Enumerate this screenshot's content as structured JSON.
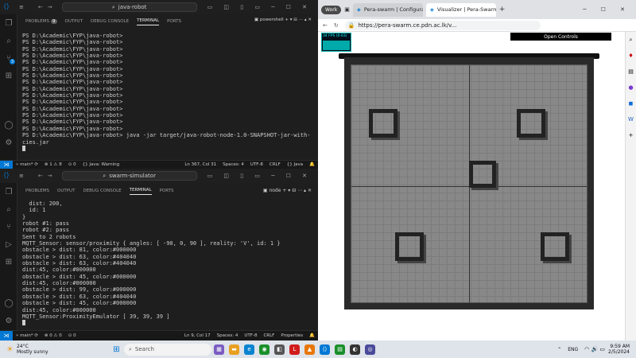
{
  "vscode": {
    "title": "java-robot",
    "top_tabs": [
      {
        "label": "PROBLEMS",
        "count": "9"
      },
      {
        "label": "OUTPUT"
      },
      {
        "label": "DEBUG CONSOLE"
      },
      {
        "label": "TERMINAL"
      },
      {
        "label": "PORTS"
      }
    ],
    "top_shell": "powershell",
    "top_lines": [
      "PS D:\\Academic\\FYP\\java-robot>",
      "PS D:\\Academic\\FYP\\java-robot>",
      "PS D:\\Academic\\FYP\\java-robot>",
      "PS D:\\Academic\\FYP\\java-robot>",
      "PS D:\\Academic\\FYP\\java-robot>",
      "PS D:\\Academic\\FYP\\java-robot>",
      "PS D:\\Academic\\FYP\\java-robot>",
      "PS D:\\Academic\\FYP\\java-robot>",
      "PS D:\\Academic\\FYP\\java-robot>",
      "PS D:\\Academic\\FYP\\java-robot>",
      "PS D:\\Academic\\FYP\\java-robot>",
      "PS D:\\Academic\\FYP\\java-robot>",
      "PS D:\\Academic\\FYP\\java-robot>",
      "PS D:\\Academic\\FYP\\java-robot>",
      "PS D:\\Academic\\FYP\\java-robot>",
      "PS D:\\Academic\\FYP\\java-robot> java -jar target/java-robot-node-1.0-SNAPSHOT-jar-with-dependen",
      "cies.jar"
    ],
    "top_status": {
      "branch": "main*",
      "sync": "⟳",
      "problems": "⊗ 1 ⚠ 8",
      "info": "⊙ 0",
      "java": "Java: Warning",
      "pos": "Ln 367, Col 31",
      "spaces": "Spaces: 4",
      "enc": "UTF-8",
      "eol": "CRLF",
      "lang": "{} Java"
    },
    "title2": "swarm-simulator",
    "bottom_tabs": [
      {
        "label": "PROBLEMS"
      },
      {
        "label": "OUTPUT"
      },
      {
        "label": "DEBUG CONSOLE"
      },
      {
        "label": "TERMINAL"
      },
      {
        "label": "PORTS"
      }
    ],
    "bottom_shell": "node",
    "bottom_lines": [
      "  dist: 200,",
      "  id: 1",
      "}",
      "robot #1: pass",
      "robot #2: pass",
      "Sent to 2 robots",
      "MQTT_Sensor: sensor/proximity { angles: [ -90, 0, 90 ], reality: 'V', id: 1 }",
      "obstacle > dist: 81, color:#000000",
      "obstacle > dist: 63, color:#404040",
      "obstacle > dist: 63, color:#404040",
      "dist:45, color:#000000",
      "obstacle > dist: 45, color:#000000",
      "dist:45, color:#000000",
      "obstacle > dist: 99, color:#000000",
      "obstacle > dist: 63, color:#404040",
      "obstacle > dist: 45, color:#000000",
      "dist:45, color:#000000",
      "MQTT_Sensor:ProximityEmulator [ 39, 39, 39 ]"
    ],
    "bottom_status": {
      "branch": "main*",
      "sync": "⟳",
      "problems": "⊗ 0 ⚠ 0",
      "info": "⊙ 0",
      "pos": "Ln 9, Col 17",
      "spaces": "Spaces: 4",
      "enc": "UTF-8",
      "eol": "CRLF",
      "lang": "Properties"
    }
  },
  "edge": {
    "profile": "Work",
    "tabs": [
      "Pera-swarm | Configurati",
      "Visualizer | Pera-Swarm"
    ],
    "url": "https://pera-swarm.ce.pdn.ac.lk/v...",
    "fps": "34 FPS (0-63)",
    "open_controls": "Open Controls"
  },
  "taskbar": {
    "temp": "24°C",
    "weather": "Mostly sunny",
    "search": "Search",
    "lang": "ENG",
    "time": "9:59 AM",
    "date": "2/5/2024"
  }
}
